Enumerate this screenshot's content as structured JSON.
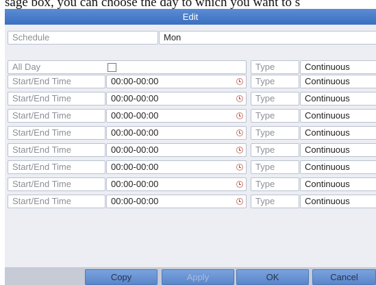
{
  "caption": "sage box, you can choose the day to which you want to s",
  "dialog": {
    "title": "Edit",
    "schedule": {
      "label": "Schedule",
      "value": "Mon"
    },
    "all_day": {
      "label": "All Day",
      "checked": false,
      "type_label": "Type",
      "type_value": "Continuous"
    },
    "rows": [
      {
        "label": "Start/End Time",
        "time": "00:00-00:00",
        "type_label": "Type",
        "type_value": "Continuous"
      },
      {
        "label": "Start/End Time",
        "time": "00:00-00:00",
        "type_label": "Type",
        "type_value": "Continuous"
      },
      {
        "label": "Start/End Time",
        "time": "00:00-00:00",
        "type_label": "Type",
        "type_value": "Continuous"
      },
      {
        "label": "Start/End Time",
        "time": "00:00-00:00",
        "type_label": "Type",
        "type_value": "Continuous"
      },
      {
        "label": "Start/End Time",
        "time": "00:00-00:00",
        "type_label": "Type",
        "type_value": "Continuous"
      },
      {
        "label": "Start/End Time",
        "time": "00:00-00:00",
        "type_label": "Type",
        "type_value": "Continuous"
      },
      {
        "label": "Start/End Time",
        "time": "00:00-00:00",
        "type_label": "Type",
        "type_value": "Continuous"
      },
      {
        "label": "Start/End Time",
        "time": "00:00-00:00",
        "type_label": "Type",
        "type_value": "Continuous"
      }
    ],
    "buttons": {
      "copy": "Copy",
      "apply": "Apply",
      "ok": "OK",
      "cancel": "Cancel"
    },
    "icons": {
      "clock": "clock-icon",
      "dropdown": "chevron-down-icon"
    },
    "colors": {
      "title_bar": "#4a7dca",
      "button": "#6994d3",
      "clock": "#c0392b"
    }
  }
}
